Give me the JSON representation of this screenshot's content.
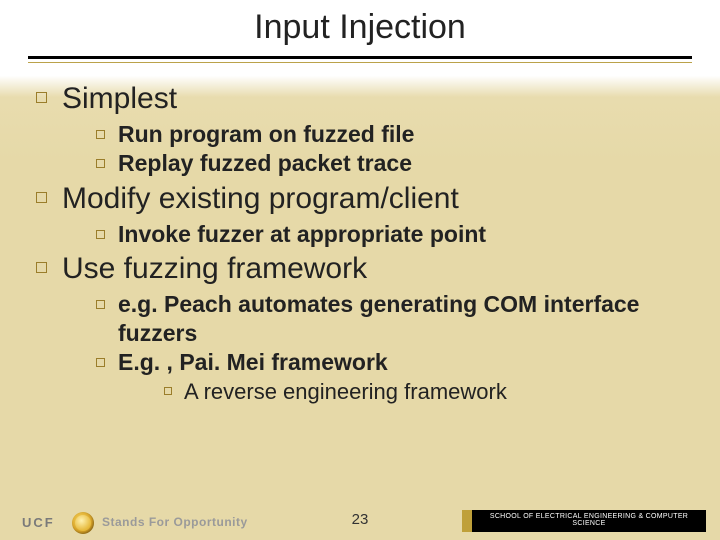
{
  "title": "Input Injection",
  "bullets": {
    "b1": "Simplest",
    "b1a": "Run program on fuzzed file",
    "b1b": "Replay fuzzed packet trace",
    "b2": "Modify existing program/client",
    "b2a": "Invoke fuzzer at appropriate point",
    "b3": "Use fuzzing framework",
    "b3a": "e.g. Peach automates generating COM interface fuzzers",
    "b3b": "E.g. , Pai. Mei framework",
    "b3b1": "A reverse engineering framework"
  },
  "footer": {
    "org": "UCF",
    "tagline": "Stands For Opportunity",
    "page": "23",
    "dept": "SCHOOL OF ELECTRICAL ENGINEERING & COMPUTER SCIENCE"
  }
}
